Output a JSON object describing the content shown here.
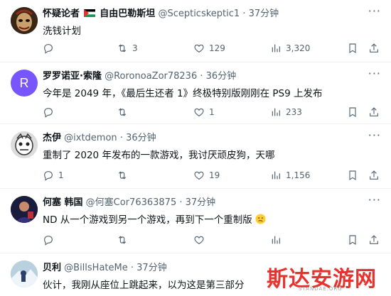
{
  "tweets": [
    {
      "name": "怀疑论者",
      "name_suffix": "自由巴勒斯坦",
      "handle": "@Scepticskeptic1",
      "time": "37分钟",
      "text": "洗钱计划",
      "reply": "",
      "retweet": "3",
      "like": "129",
      "views": "3,320",
      "avatar": "mask-avatar"
    },
    {
      "name": "罗罗诺亚·索隆",
      "handle": "@RoronoaZor78236",
      "time": "36分钟",
      "text": "今年是 2049 年，《最后生还者 1》终极特别版刚刚在 PS9 上发布",
      "reply": "",
      "retweet": "",
      "like": "1",
      "views": "233",
      "avatar_letter": "R",
      "avatar_color": "#7856ff"
    },
    {
      "name": "杰伊",
      "handle": "@ixtdemon",
      "time": "36分钟",
      "text": "重制了 2020 年发布的一款游戏，我讨厌顽皮狗，天哪",
      "reply": "1",
      "retweet": "",
      "like": "19",
      "views": "1,156",
      "avatar": "cartoon-avatar"
    },
    {
      "name": "何塞 韩国",
      "handle": "@何塞Cor76363875",
      "time": "37分钟",
      "text": "ND 从一个游戏到另一个游戏，再到下一个重制版",
      "reply": "",
      "retweet": "",
      "like": "",
      "views": "",
      "avatar": "photo-avatar"
    },
    {
      "name": "贝利",
      "handle": "@BillsHateMe",
      "time": "37分钟",
      "text": "伙计，我刚从座位上跳起来，以为这是第三部分",
      "avatar": "snow-avatar"
    }
  ],
  "separator": "·",
  "more_icon": "more-dots-icon",
  "watermark": {
    "title": "斯达安游网",
    "sub": "STANDAE.ORG"
  },
  "colors": {
    "text": "#0f1419",
    "muted": "#536471",
    "accent_purple": "#7856ff",
    "watermark": "#e8322e"
  }
}
